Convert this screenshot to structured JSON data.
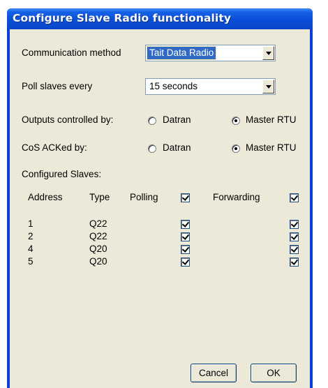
{
  "window": {
    "title": "Configure Slave Radio functionality"
  },
  "comm": {
    "label": "Communication method",
    "value": "Tait Data Radio"
  },
  "poll": {
    "label": "Poll slaves every",
    "value": "15 seconds"
  },
  "outputs": {
    "label": "Outputs controlled by:",
    "opt1": "Datran",
    "opt2": "Master RTU",
    "selected": "Master RTU"
  },
  "cos": {
    "label": "CoS ACKed by:",
    "opt1": "Datran",
    "opt2": "Master RTU",
    "selected": "Master RTU"
  },
  "slaves": {
    "label": "Configured Slaves:",
    "headers": {
      "address": "Address",
      "type": "Type",
      "polling": "Polling",
      "forwarding": "Forwarding"
    },
    "header_polling_checked": true,
    "header_forwarding_checked": true,
    "rows": [
      {
        "address": "1",
        "type": "Q22",
        "polling": true,
        "forwarding": true
      },
      {
        "address": "2",
        "type": "Q22",
        "polling": true,
        "forwarding": true
      },
      {
        "address": "4",
        "type": "Q20",
        "polling": true,
        "forwarding": true
      },
      {
        "address": "5",
        "type": "Q20",
        "polling": true,
        "forwarding": true
      }
    ]
  },
  "buttons": {
    "cancel": "Cancel",
    "ok": "OK"
  }
}
